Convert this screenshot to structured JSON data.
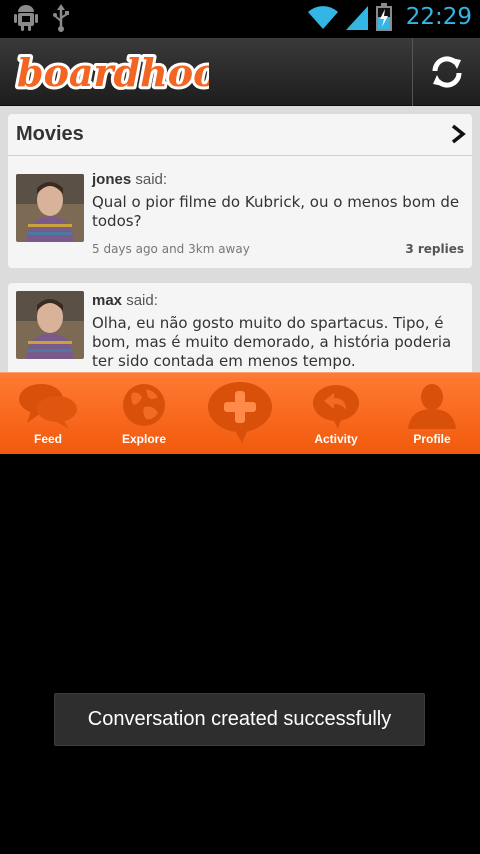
{
  "statusbar": {
    "time": "22:29",
    "icons": [
      "android-debug-icon",
      "usb-icon",
      "wifi-icon",
      "signal-icon",
      "battery-charging-icon"
    ]
  },
  "app": {
    "logo_text": "boardhood",
    "refresh_icon": "refresh-icon",
    "accent_color": "#f26522"
  },
  "topic": {
    "title": "Movies"
  },
  "posts": [
    {
      "author": "jones",
      "said": "said:",
      "message": "Qual o pior filme do Kubrick, ou o menos bom de todos?",
      "meta": "5 days ago and 3km away",
      "replies": "3 replies"
    },
    {
      "author": "max",
      "said": "said:",
      "message": "Olha, eu não gosto muito do spartacus. Tipo, é bom, mas é muito demorado, a história poderia ter sido contada em menos tempo."
    }
  ],
  "tabs": [
    {
      "label": "Feed",
      "icon": "chat-bubbles-icon"
    },
    {
      "label": "Explore",
      "icon": "globe-icon"
    },
    {
      "label": "",
      "icon": "add-conversation-icon"
    },
    {
      "label": "Activity",
      "icon": "reply-bubble-icon"
    },
    {
      "label": "Profile",
      "icon": "person-icon"
    }
  ],
  "toast": {
    "message": "Conversation created successfully"
  }
}
